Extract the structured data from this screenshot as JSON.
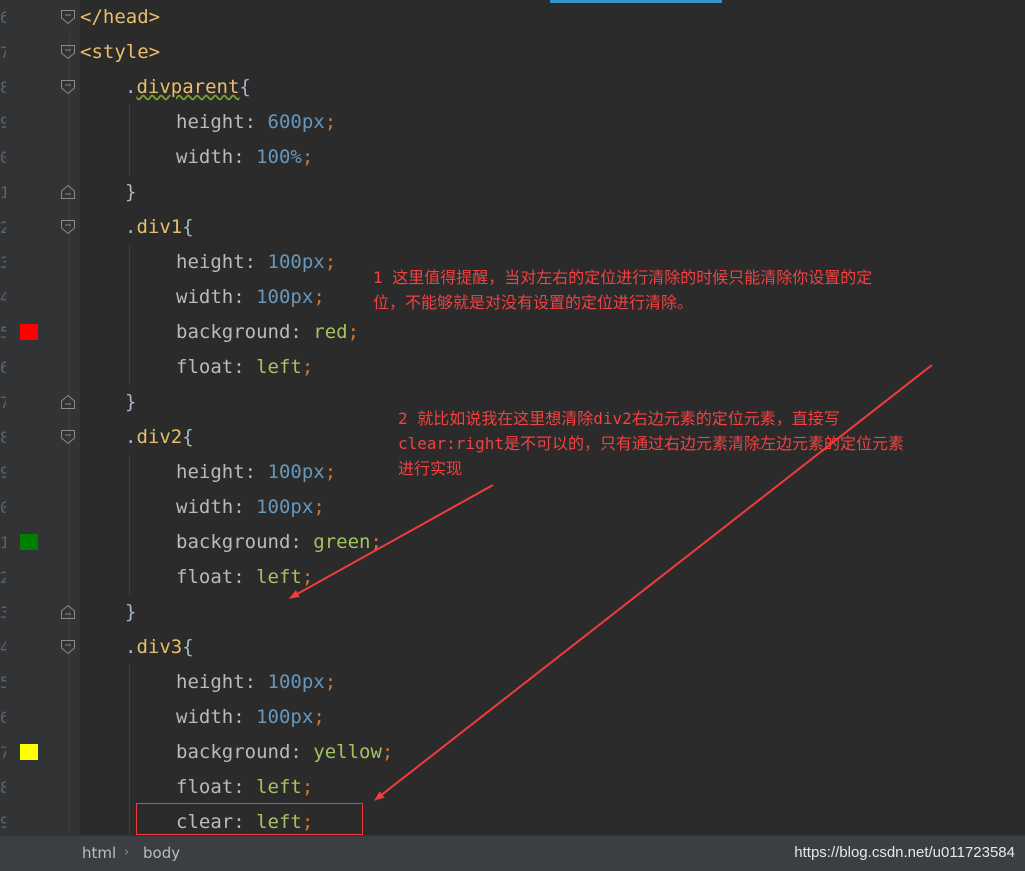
{
  "editor": {
    "lines": [
      {
        "num": "6",
        "tokens": [
          [
            "tag",
            "</head>"
          ]
        ]
      },
      {
        "num": "7",
        "tokens": [
          [
            "tag",
            "<style>"
          ]
        ]
      },
      {
        "num": "8",
        "tokens": [
          [
            "punc",
            "."
          ],
          [
            "selu",
            "divparent"
          ],
          [
            "punc",
            "{"
          ]
        ]
      },
      {
        "num": "9",
        "tokens": [
          [
            "prop",
            "height"
          ],
          [
            "punc",
            ": "
          ],
          [
            "num",
            "600"
          ],
          [
            "unit",
            "px"
          ],
          [
            "semi",
            ";"
          ]
        ]
      },
      {
        "num": "0",
        "tokens": [
          [
            "prop",
            "width"
          ],
          [
            "punc",
            ": "
          ],
          [
            "num",
            "100"
          ],
          [
            "unit",
            "%"
          ],
          [
            "semi",
            ";"
          ]
        ]
      },
      {
        "num": "1",
        "tokens": [
          [
            "punc",
            "}"
          ]
        ]
      },
      {
        "num": "2",
        "tokens": [
          [
            "punc",
            "."
          ],
          [
            "sel",
            "div1"
          ],
          [
            "punc",
            "{"
          ]
        ]
      },
      {
        "num": "3",
        "tokens": [
          [
            "prop",
            "height"
          ],
          [
            "punc",
            ": "
          ],
          [
            "num",
            "100"
          ],
          [
            "unit",
            "px"
          ],
          [
            "semi",
            ";"
          ]
        ]
      },
      {
        "num": "4",
        "tokens": [
          [
            "prop",
            "width"
          ],
          [
            "punc",
            ": "
          ],
          [
            "num",
            "100"
          ],
          [
            "unit",
            "px"
          ],
          [
            "semi",
            ";"
          ]
        ]
      },
      {
        "num": "5",
        "tokens": [
          [
            "prop",
            "background"
          ],
          [
            "punc",
            ": "
          ],
          [
            "val",
            "red"
          ],
          [
            "semi",
            ";"
          ]
        ],
        "swatch": "#ff0000"
      },
      {
        "num": "6",
        "tokens": [
          [
            "prop",
            "float"
          ],
          [
            "punc",
            ": "
          ],
          [
            "val",
            "left"
          ],
          [
            "semi",
            ";"
          ]
        ]
      },
      {
        "num": "7",
        "tokens": [
          [
            "punc",
            "}"
          ]
        ]
      },
      {
        "num": "8",
        "tokens": [
          [
            "punc",
            "."
          ],
          [
            "sel",
            "div2"
          ],
          [
            "punc",
            "{"
          ]
        ]
      },
      {
        "num": "9",
        "tokens": [
          [
            "prop",
            "height"
          ],
          [
            "punc",
            ": "
          ],
          [
            "num",
            "100"
          ],
          [
            "unit",
            "px"
          ],
          [
            "semi",
            ";"
          ]
        ]
      },
      {
        "num": "0",
        "tokens": [
          [
            "prop",
            "width"
          ],
          [
            "punc",
            ": "
          ],
          [
            "num",
            "100"
          ],
          [
            "unit",
            "px"
          ],
          [
            "semi",
            ";"
          ]
        ]
      },
      {
        "num": "1",
        "tokens": [
          [
            "prop",
            "background"
          ],
          [
            "punc",
            ": "
          ],
          [
            "val",
            "green"
          ],
          [
            "semi",
            ";"
          ]
        ],
        "swatch": "#008000"
      },
      {
        "num": "2",
        "tokens": [
          [
            "prop",
            "float"
          ],
          [
            "punc",
            ": "
          ],
          [
            "val",
            "left"
          ],
          [
            "semi",
            ";"
          ]
        ]
      },
      {
        "num": "3",
        "tokens": [
          [
            "punc",
            "}"
          ]
        ]
      },
      {
        "num": "4",
        "tokens": [
          [
            "punc",
            "."
          ],
          [
            "sel",
            "div3"
          ],
          [
            "punc",
            "{"
          ]
        ]
      },
      {
        "num": "5",
        "tokens": [
          [
            "prop",
            "height"
          ],
          [
            "punc",
            ": "
          ],
          [
            "num",
            "100"
          ],
          [
            "unit",
            "px"
          ],
          [
            "semi",
            ";"
          ]
        ]
      },
      {
        "num": "6",
        "tokens": [
          [
            "prop",
            "width"
          ],
          [
            "punc",
            ": "
          ],
          [
            "num",
            "100"
          ],
          [
            "unit",
            "px"
          ],
          [
            "semi",
            ";"
          ]
        ]
      },
      {
        "num": "7",
        "tokens": [
          [
            "prop",
            "background"
          ],
          [
            "punc",
            ": "
          ],
          [
            "val",
            "yellow"
          ],
          [
            "semi",
            ";"
          ]
        ],
        "swatch": "#ffff00"
      },
      {
        "num": "8",
        "tokens": [
          [
            "prop",
            "float"
          ],
          [
            "punc",
            ": "
          ],
          [
            "val",
            "left"
          ],
          [
            "semi",
            ";"
          ]
        ]
      },
      {
        "num": "9",
        "tokens": [
          [
            "prop",
            "clear"
          ],
          [
            "punc",
            ": "
          ],
          [
            "val",
            "left"
          ],
          [
            "semi",
            ";"
          ]
        ]
      }
    ]
  },
  "annotations": {
    "note1": "1 这里值得提醒，当对左右的定位进行清除的时候只能清除你设置的定\n位，不能够就是对没有设置的定位进行清除。",
    "note2": "2 就比如说我在这里想清除div2右边元素的定位元素，直接写\nclear:right是不可以的，只有通过右边元素清除左边元素的定位元素\n进行实现"
  },
  "statusbar": {
    "crumb1": "html",
    "separator": "›",
    "crumb2": "body",
    "watermark": "https://blog.csdn.net/u011723584"
  },
  "colors": {
    "annotation": "#f24141",
    "swatch_red": "#ff0000",
    "swatch_green": "#008000",
    "swatch_yellow": "#ffff00"
  }
}
